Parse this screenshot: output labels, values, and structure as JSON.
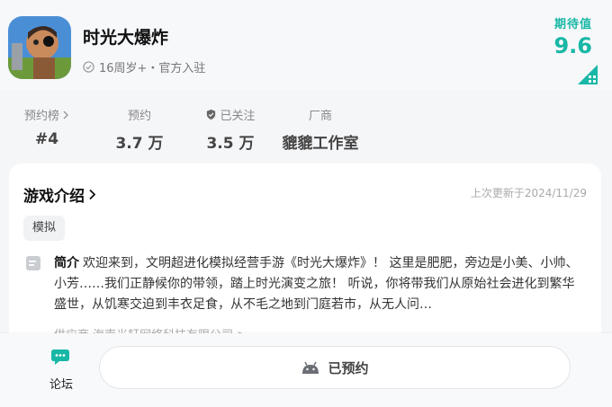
{
  "app": {
    "title": "时光大爆炸",
    "meta": "16周岁+・官方入驻",
    "expect_label": "期待值",
    "expect_score": "9.6"
  },
  "stats": [
    {
      "label": "预约榜",
      "value": "#4"
    },
    {
      "label": "预约",
      "value": "3.7 万"
    },
    {
      "label": "已关注",
      "value": "3.5 万"
    },
    {
      "label": "厂商",
      "value": "貔貔工作室"
    }
  ],
  "intro": {
    "title": "游戏介绍",
    "updated": "上次更新于2024/11/29",
    "tag": "模拟",
    "desc_label": "简介",
    "desc_text": "欢迎来到，文明超进化模拟经营手游《时光大爆炸》！ 这里是肥肥，旁边是小美、小帅、小芳……我们正静候你的带领，踏上时光演变之旅！ 听说，你将带我们从原始社会进化到繁华盛世，从饥寒交迫到丰衣足食，从不毛之地到门庭若市，从无人问…",
    "supplier": "供应商 海南光轩网络科技有限公司 >"
  },
  "bottom": {
    "forum_label": "论坛",
    "reserved_label": "已预约"
  },
  "colors": {
    "accent": "#18b7a6"
  }
}
